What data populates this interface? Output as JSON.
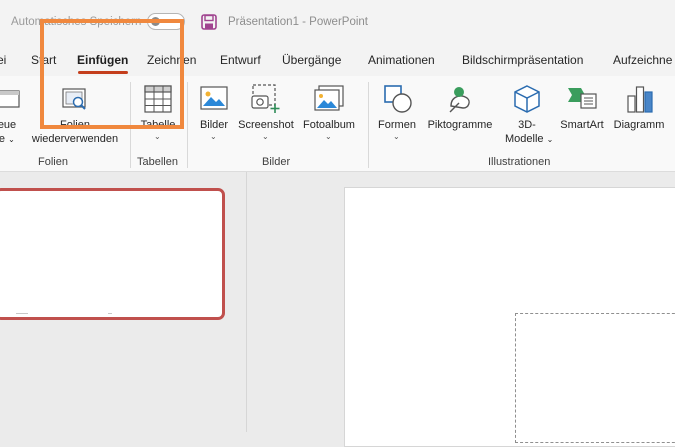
{
  "titlebar": {
    "autosave_label": "Automatisches Speichern",
    "document_title": "Präsentation1  -  PowerPoint"
  },
  "tabs": [
    {
      "label": "ei"
    },
    {
      "label": "Start"
    },
    {
      "label": "Einfügen"
    },
    {
      "label": "Zeichnen"
    },
    {
      "label": "Entwurf"
    },
    {
      "label": "Übergänge"
    },
    {
      "label": "Animationen"
    },
    {
      "label": "Bildschirmpräsentation"
    },
    {
      "label": "Aufzeichne"
    }
  ],
  "ribbon": {
    "groups": {
      "folien": "Folien",
      "tabellen": "Tabellen",
      "bilder": "Bilder",
      "illustrationen": "Illustrationen"
    },
    "buttons": {
      "neue_line1": "eue",
      "neue_line2": "lie",
      "folien_line1": "Folien",
      "folien_line2": "wiederverwenden",
      "tabelle": "Tabelle",
      "bilder": "Bilder",
      "screenshot": "Screenshot",
      "fotoalbum": "Fotoalbum",
      "formen": "Formen",
      "piktogramme": "Piktogramme",
      "modelle_line1": "3D-",
      "modelle_line2": "Modelle",
      "smartart": "SmartArt",
      "diagramm": "Diagramm"
    }
  },
  "colors": {
    "accent_tab": "#c43e1c",
    "highlight": "#f0883e",
    "save_icon": "#a0438f",
    "smartart_green": "#3a9d5d",
    "chart_blue": "#4a86c8"
  }
}
